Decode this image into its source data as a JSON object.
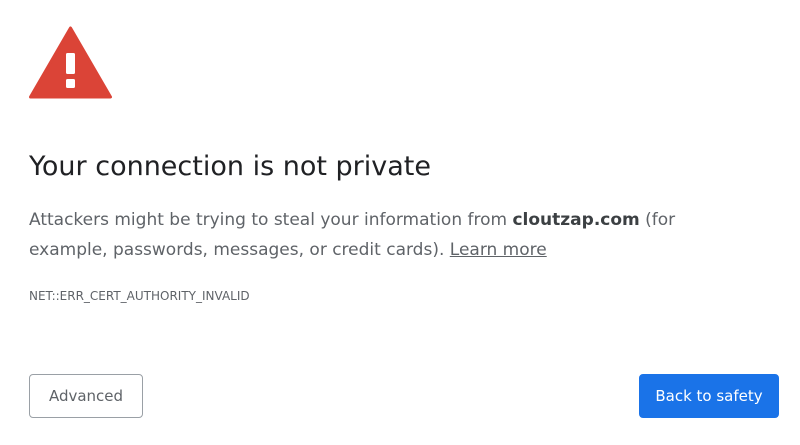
{
  "interstitial": {
    "title": "Your connection is not private",
    "message_prefix": "Attackers might be trying to steal your information from ",
    "domain": "cloutzap.com",
    "message_suffix": " (for example, passwords, messages, or credit cards). ",
    "learn_more": "Learn more",
    "error_code": "NET::ERR_CERT_AUTHORITY_INVALID",
    "icon": "warning-triangle-icon",
    "icon_color": "#db4437"
  },
  "buttons": {
    "advanced_label": "Advanced",
    "back_to_safety_label": "Back to safety",
    "primary_color": "#1a73e8"
  }
}
